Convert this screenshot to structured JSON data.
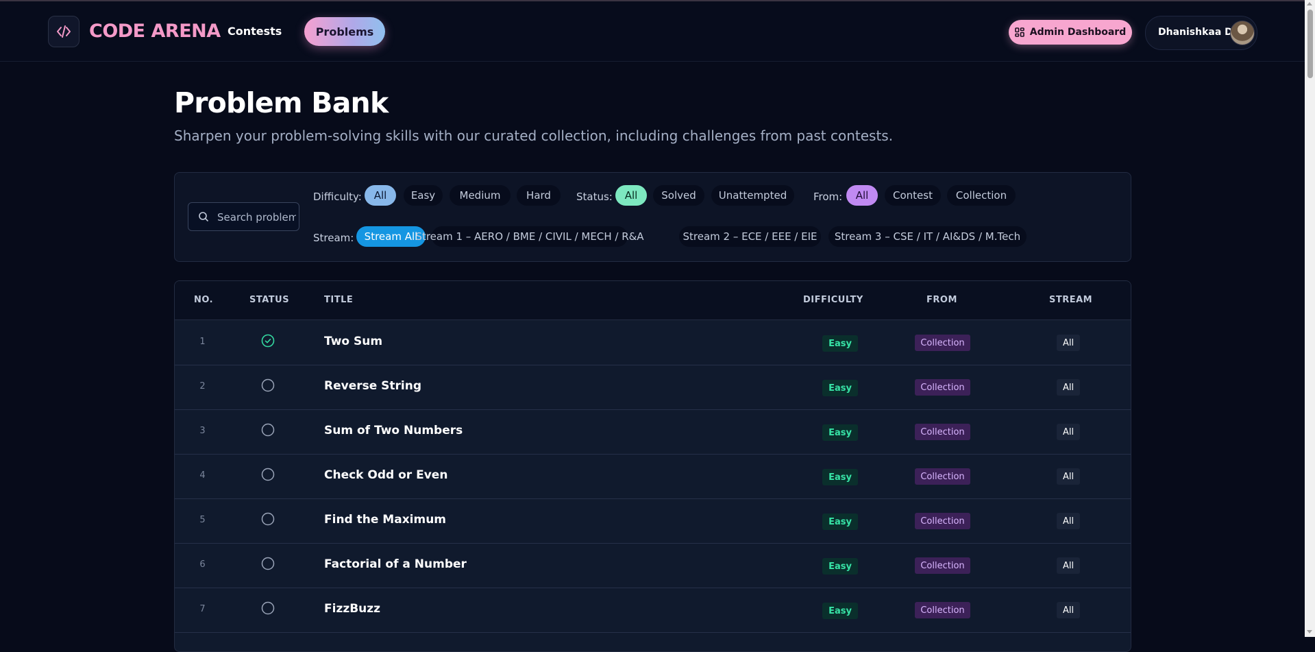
{
  "brand": {
    "name": "CODE ARENA",
    "logo_icon": "code-brackets-icon"
  },
  "nav": {
    "contests": "Contests",
    "problems": "Problems"
  },
  "header": {
    "admin_label": "Admin Dashboard",
    "user_name": "Dhanishkaa D"
  },
  "page": {
    "title": "Problem Bank",
    "subtitle": "Sharpen your problem-solving skills with our curated collection, including challenges from past contests."
  },
  "filters": {
    "search_placeholder": "Search problems",
    "difficulty_label": "Difficulty:",
    "difficulty_options": [
      "All",
      "Easy",
      "Medium",
      "Hard"
    ],
    "status_label": "Status:",
    "status_options": [
      "All",
      "Solved",
      "Unattempted"
    ],
    "from_label": "From:",
    "from_options": [
      "All",
      "Contest",
      "Collection"
    ],
    "stream_label": "Stream:",
    "stream_options": [
      "Stream All",
      "Stream 1 – AERO / BME / CIVIL / MECH / R&A",
      "Stream 2 – ECE / EEE / EIE",
      "Stream 3 – CSE / IT / AI&DS / M.Tech"
    ]
  },
  "table": {
    "headers": {
      "no": "NO.",
      "status": "STATUS",
      "title": "TITLE",
      "difficulty": "DIFFICULTY",
      "from": "FROM",
      "stream": "STREAM"
    },
    "rows": [
      {
        "no": "1",
        "solved": true,
        "title": "Two Sum",
        "difficulty": "Easy",
        "from": "Collection",
        "stream": "All"
      },
      {
        "no": "2",
        "solved": false,
        "title": "Reverse String",
        "difficulty": "Easy",
        "from": "Collection",
        "stream": "All"
      },
      {
        "no": "3",
        "solved": false,
        "title": "Sum of Two Numbers",
        "difficulty": "Easy",
        "from": "Collection",
        "stream": "All"
      },
      {
        "no": "4",
        "solved": false,
        "title": "Check Odd or Even",
        "difficulty": "Easy",
        "from": "Collection",
        "stream": "All"
      },
      {
        "no": "5",
        "solved": false,
        "title": "Find the Maximum",
        "difficulty": "Easy",
        "from": "Collection",
        "stream": "All"
      },
      {
        "no": "6",
        "solved": false,
        "title": "Factorial of a Number",
        "difficulty": "Easy",
        "from": "Collection",
        "stream": "All"
      },
      {
        "no": "7",
        "solved": false,
        "title": "FizzBuzz",
        "difficulty": "Easy",
        "from": "Collection",
        "stream": "All"
      }
    ]
  },
  "colors": {
    "accent_pink": "#f49ac8",
    "easy_green": "#37e3a6",
    "collection_purple": "#d9b6ff",
    "stream_blue": "#1596e2",
    "background": "#070b1a"
  }
}
